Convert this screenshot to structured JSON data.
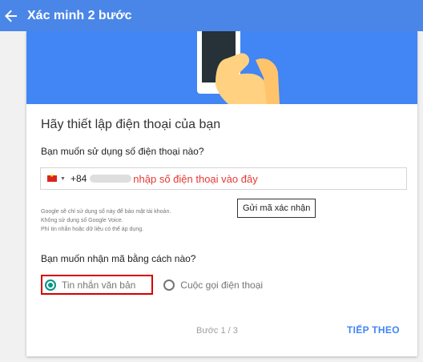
{
  "appbar": {
    "title": "Xác minh 2 bước",
    "back_icon": "arrow-left-icon"
  },
  "hero": {
    "illustration": "hand-holding-phone"
  },
  "form": {
    "heading": "Hãy thiết lập điện thoại của bạn",
    "phone_question": "Bạn muốn sử dụng số điện thoại nào?",
    "phone": {
      "country_flag": "vietnam-flag-icon",
      "dial_code": "+84",
      "hint_text": "nhập số điện thoại vào đây"
    },
    "send_code_label": "Gửi mã xác nhận",
    "disclaimer": [
      "Google sẽ chỉ sử dụng số này để bảo mật tài khoản.",
      "Không sử dụng số Google Voice.",
      "Phí tin nhắn hoặc dữ liệu có thể áp dụng."
    ],
    "method_question": "Bạn muốn nhận mã bằng cách nào?",
    "methods": [
      {
        "label": "Tin nhắn văn bản",
        "selected": true
      },
      {
        "label": "Cuộc gọi điện thoại",
        "selected": false
      }
    ]
  },
  "footer": {
    "step": "Bước 1 / 3",
    "next_label": "TIẾP THEO"
  },
  "colors": {
    "appbar": "#4a86e8",
    "hero": "#4285f4",
    "accent_radio": "#009688",
    "highlight": "#d50000",
    "hint": "#e53935",
    "link": "#4285f4"
  }
}
